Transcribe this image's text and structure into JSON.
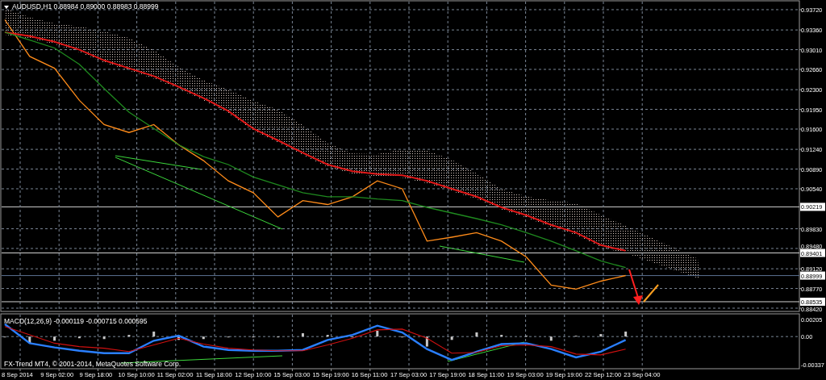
{
  "chart_window": {
    "title": "AUDUSD,H1  0.88984 0.89000 0.88983 0.88999"
  },
  "price_chart": {
    "chart_data": {
      "type": "line",
      "grid": true,
      "ylim": [
        0.88377,
        0.93863
      ],
      "series": [
        {
          "color": "#ff8c1a",
          "values": [
            0.9354,
            0.9289,
            0.9268,
            0.9211,
            0.9168,
            0.9154,
            0.9168,
            0.9132,
            0.9104,
            0.9068,
            0.9047,
            0.9004,
            0.9033,
            0.9026,
            0.904,
            0.9068,
            0.9054,
            0.8961,
            0.8968,
            0.8976,
            0.8961,
            0.8933,
            0.8883,
            0.8876,
            0.889,
            0.89,
            null,
            null,
            null
          ]
        },
        {
          "color": "#e01818",
          "values": [
            0.9332,
            0.9325,
            0.9315,
            0.9301,
            0.9282,
            0.9268,
            0.9254,
            0.9235,
            0.9215,
            0.9192,
            0.9161,
            0.914,
            0.9118,
            0.9097,
            0.9085,
            0.908,
            0.9078,
            0.9068,
            0.9054,
            0.904,
            0.9021,
            0.9007,
            0.899,
            0.8976,
            0.8954,
            0.8944,
            null,
            null,
            null
          ]
        },
        {
          "color": "#1f8a1f",
          "values": [
            0.9332,
            0.9318,
            0.9304,
            0.9275,
            0.9232,
            0.919,
            0.9161,
            0.9132,
            0.9111,
            0.9097,
            0.9075,
            0.9061,
            0.9047,
            0.904,
            0.904,
            0.9036,
            0.9033,
            0.9021,
            0.9011,
            0.9001,
            0.899,
            0.8976,
            0.8961,
            0.8944,
            0.8926,
            0.8914,
            null,
            null,
            null
          ]
        }
      ],
      "yticks": [
        {
          "value": 0.9372,
          "label": "0.93720"
        },
        {
          "value": 0.9336,
          "label": "0.93360"
        },
        {
          "value": 0.9301,
          "label": "0.93010"
        },
        {
          "value": 0.9266,
          "label": "0.92660"
        },
        {
          "value": 0.923,
          "label": "0.92300"
        },
        {
          "value": 0.9195,
          "label": "0.91950"
        },
        {
          "value": 0.916,
          "label": "0.91600"
        },
        {
          "value": 0.9124,
          "label": "0.91240"
        },
        {
          "value": 0.9089,
          "label": "0.90890"
        },
        {
          "value": 0.9054,
          "label": "0.90540"
        },
        {
          "value": 0.8983,
          "label": "0.89830"
        },
        {
          "value": 0.8948,
          "label": "0.89480"
        },
        {
          "value": 0.8912,
          "label": "0.89120"
        },
        {
          "value": 0.8877,
          "label": "0.88770"
        },
        {
          "value": 0.8842,
          "label": "0.88420"
        }
      ]
    },
    "price_tags": [
      {
        "label": "0.90219",
        "kind": "level"
      },
      {
        "label": "0.89401",
        "kind": "level"
      },
      {
        "label": "0.88999",
        "kind": "bid"
      },
      {
        "label": "0.88535",
        "kind": "level"
      }
    ]
  },
  "macd": {
    "label": "MACD(12,26,9) -0.000119 -0.000715 0.000595",
    "chart_data": {
      "type": "line",
      "grid": true,
      "ylim": [
        -0.00376,
        0.00263
      ],
      "series": [
        {
          "type": "bar",
          "color": "#c8c8c8",
          "values": [
            0,
            -0.0008,
            -0.0005,
            -0.0002,
            -0.0003,
            0.0002,
            0.0006,
            -0.0004,
            -0.0003,
            -0.0001,
            0,
            0,
            0.0004,
            0.0002,
            0,
            0.0007,
            0,
            -0.0012,
            -0.0004,
            0.0005,
            0.0002,
            0.0001,
            -0.0005,
            0.0001,
            0.0003,
            0.0006,
            null,
            null,
            null
          ]
        },
        {
          "type": "line",
          "color": "#2a7fff",
          "values": [
            0.0015,
            -0.0008,
            -0.0013,
            -0.0017,
            -0.002,
            -0.002,
            -0.0005,
            0.0001,
            -0.0012,
            -0.0016,
            -0.0017,
            -0.0017,
            -0.0016,
            -0.0004,
            0.0002,
            0.0013,
            0.0005,
            -0.0015,
            -0.0028,
            -0.0018,
            -0.0009,
            -0.0008,
            -0.0015,
            -0.0025,
            -0.0018,
            -0.0004,
            null,
            null,
            null
          ]
        },
        {
          "type": "line",
          "color": "#d01010",
          "values": [
            0.0012,
            0.0002,
            -0.0008,
            -0.0012,
            -0.0014,
            -0.0018,
            -0.001,
            -0.0002,
            -0.0009,
            -0.0014,
            -0.0016,
            -0.0017,
            -0.0017,
            -0.001,
            -0.0002,
            0.0008,
            0.0009,
            -0.0002,
            -0.002,
            -0.0019,
            -0.0011,
            -0.001,
            -0.0012,
            -0.0021,
            -0.0022,
            -0.0015,
            null,
            null,
            null
          ]
        }
      ],
      "yticks": [
        {
          "value": 0.00205,
          "label": "0.00205"
        },
        {
          "value": 0,
          "label": "0.00"
        },
        {
          "value": -0.00337,
          "label": "-0.00337"
        }
      ]
    }
  },
  "copyright": "FX-Trend MT4, © 2001-2014, MetaQuotes Software Corp.",
  "time_axis": [
    "8 Sep 2014",
    "9 Sep 02:00",
    "9 Sep 18:00",
    "10 Sep 10:00",
    "11 Sep 02:00",
    "11 Sep 18:00",
    "12 Sep 10:00",
    "15 Sep 03:00",
    "15 Sep 19:00",
    "16 Sep 11:00",
    "17 Sep 03:00",
    "17 Sep 19:00",
    "18 Sep 11:00",
    "19 Sep 03:00",
    "19 Sep 19:00",
    "22 Sep 12:00",
    "23 Sep 04:00"
  ]
}
